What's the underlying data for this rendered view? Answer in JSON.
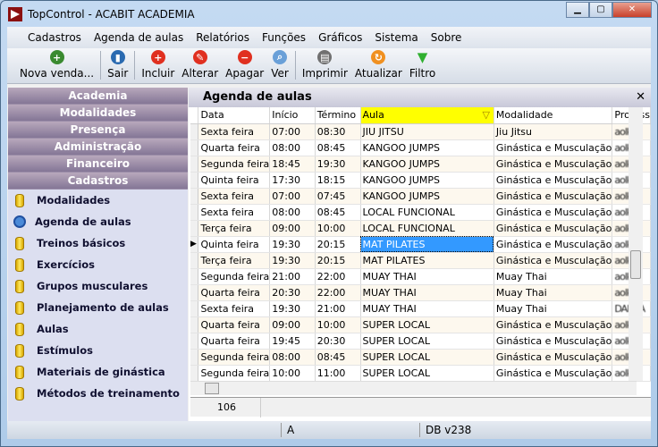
{
  "window": {
    "title": "TopControl - ACABIT ACADEMIA"
  },
  "menu": [
    "Cadastros",
    "Agenda de aulas",
    "Relatórios",
    "Funções",
    "Gráficos",
    "Sistema",
    "Sobre"
  ],
  "toolbar": [
    {
      "label": "Nova venda...",
      "icon": "add-user-icon",
      "color": "#3a8a30"
    },
    {
      "label": "Sair",
      "icon": "exit-door-icon",
      "color": "#2a6ab0"
    },
    {
      "label": "Incluir",
      "icon": "plus-circle-icon",
      "color": "#e03020"
    },
    {
      "label": "Alterar",
      "icon": "edit-circle-icon",
      "color": "#e03020"
    },
    {
      "label": "Apagar",
      "icon": "minus-circle-icon",
      "color": "#e03020"
    },
    {
      "label": "Ver",
      "icon": "magnifier-icon",
      "color": "#6aa0d8"
    },
    {
      "label": "Imprimir",
      "icon": "printer-icon",
      "color": "#707070"
    },
    {
      "label": "Atualizar",
      "icon": "refresh-icon",
      "color": "#f09020"
    },
    {
      "label": "Filtro",
      "icon": "filter-icon",
      "color": "#30b030"
    }
  ],
  "sidebar": {
    "groups": [
      "Academia",
      "Modalidades",
      "Presença",
      "Administração",
      "Financeiro",
      "Cadastros"
    ],
    "items": [
      {
        "label": "Modalidades",
        "icon": "database-icon"
      },
      {
        "label": "Agenda de aulas",
        "icon": "stopwatch-icon"
      },
      {
        "label": "Treinos básicos",
        "icon": "database-icon"
      },
      {
        "label": "Exercícios",
        "icon": "database-icon"
      },
      {
        "label": "Grupos musculares",
        "icon": "database-icon"
      },
      {
        "label": "Planejamento de aulas",
        "icon": "database-icon"
      },
      {
        "label": "Aulas",
        "icon": "database-icon"
      },
      {
        "label": "Estímulos",
        "icon": "database-icon"
      },
      {
        "label": "Materiais de ginástica",
        "icon": "database-icon"
      },
      {
        "label": "Métodos de treinamento",
        "icon": "database-icon"
      }
    ]
  },
  "panel": {
    "title": "Agenda de aulas",
    "close": "✕"
  },
  "grid": {
    "columns": [
      "Data",
      "Início",
      "Término",
      "Aula",
      "Modalidade",
      "Profess"
    ],
    "sorted_column": "Aula",
    "selected_row": 7,
    "rows": [
      [
        "Sexta feira",
        "07:00",
        "08:30",
        "JIU JITSU",
        "Jiu Jitsu",
        "aolkik"
      ],
      [
        "Quarta feira",
        "08:00",
        "08:45",
        "KANGOO JUMPS",
        "Ginástica e Musculação",
        "aolkik"
      ],
      [
        "Segunda feira",
        "18:45",
        "19:30",
        "KANGOO JUMPS",
        "Ginástica e Musculação",
        "aolkik"
      ],
      [
        "Quinta feira",
        "17:30",
        "18:15",
        "KANGOO JUMPS",
        "Ginástica e Musculação",
        "aolkik"
      ],
      [
        "Sexta feira",
        "07:00",
        "07:45",
        "KANGOO JUMPS",
        "Ginástica e Musculação",
        "aolkik"
      ],
      [
        "Sexta feira",
        "08:00",
        "08:45",
        "LOCAL FUNCIONAL",
        "Ginástica e Musculação",
        "aolkik"
      ],
      [
        "Terça feira",
        "09:00",
        "10:00",
        "LOCAL FUNCIONAL",
        "Ginástica e Musculação",
        "aolkik"
      ],
      [
        "Quinta feira",
        "19:30",
        "20:15",
        "MAT PILATES",
        "Ginástica e Musculação",
        "aolkik"
      ],
      [
        "Terça feira",
        "19:30",
        "20:15",
        "MAT PILATES",
        "Ginástica e Musculação",
        "aolkik"
      ],
      [
        "Segunda feira",
        "21:00",
        "22:00",
        "MUAY THAI",
        "Muay Thai",
        "aolkik"
      ],
      [
        "Quarta feira",
        "20:30",
        "22:00",
        "MUAY THAI",
        "Muay Thai",
        "aolkik"
      ],
      [
        "Sexta feira",
        "19:30",
        "21:00",
        "MUAY THAI",
        "Muay Thai",
        "DAMPA"
      ],
      [
        "Quarta feira",
        "09:00",
        "10:00",
        "SUPER LOCAL",
        "Ginástica e Musculação",
        "aolkik"
      ],
      [
        "Quarta feira",
        "19:45",
        "20:30",
        "SUPER LOCAL",
        "Ginástica e Musculação",
        "aolkik"
      ],
      [
        "Segunda feira",
        "08:00",
        "08:45",
        "SUPER LOCAL",
        "Ginástica e Musculação",
        "aolkik"
      ],
      [
        "Segunda feira",
        "10:00",
        "11:00",
        "SUPER LOCAL",
        "Ginástica e Musculação",
        "aolkik"
      ]
    ],
    "record_count": "106"
  },
  "status": {
    "field1": "",
    "field2": "A",
    "field3": "DB v238"
  }
}
